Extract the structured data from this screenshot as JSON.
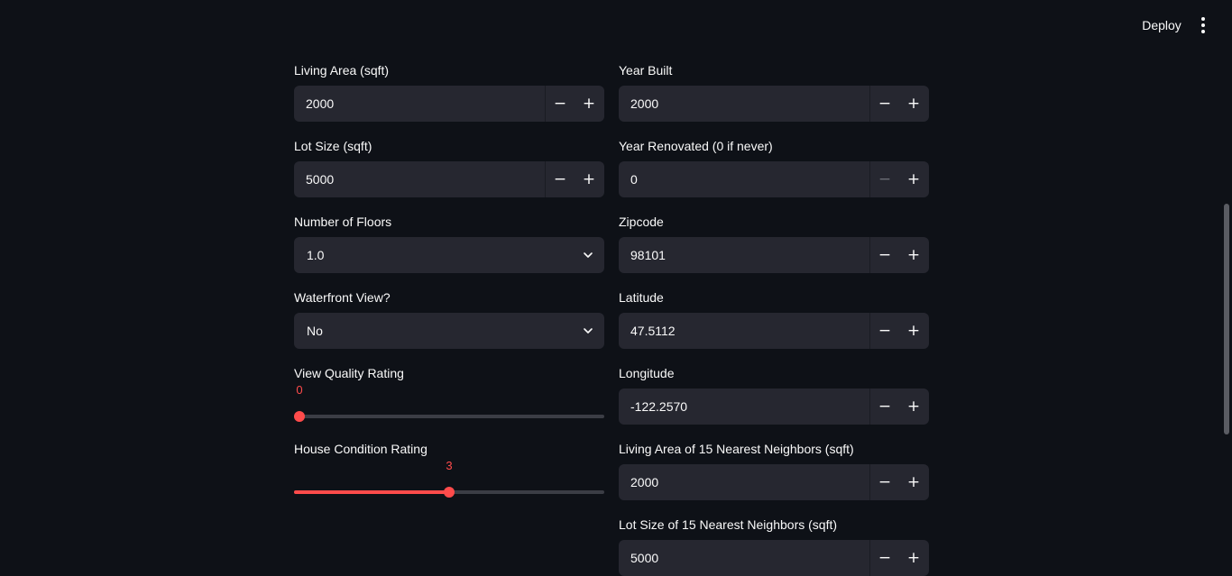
{
  "header": {
    "deploy_label": "Deploy",
    "menu_icon": "kebab-menu-icon"
  },
  "form": {
    "living_area": {
      "label": "Living Area (sqft)",
      "value": "2000"
    },
    "lot_size": {
      "label": "Lot Size (sqft)",
      "value": "5000"
    },
    "floors": {
      "label": "Number of Floors",
      "selected": "1.0"
    },
    "waterfront": {
      "label": "Waterfront View?",
      "selected": "No"
    },
    "view_rating": {
      "label": "View Quality Rating",
      "value": "0",
      "min": 0,
      "max": 4,
      "current": 0
    },
    "condition_rating": {
      "label": "House Condition Rating",
      "value": "3",
      "min": 1,
      "max": 5,
      "current": 3
    },
    "year_built": {
      "label": "Year Built",
      "value": "2000"
    },
    "year_renovated": {
      "label": "Year Renovated (0 if never)",
      "value": "0"
    },
    "zipcode": {
      "label": "Zipcode",
      "value": "98101"
    },
    "latitude": {
      "label": "Latitude",
      "value": "47.5112"
    },
    "longitude": {
      "label": "Longitude",
      "value": "-122.2570"
    },
    "living_area_15": {
      "label": "Living Area of 15 Nearest Neighbors (sqft)",
      "value": "2000"
    },
    "lot_size_15": {
      "label": "Lot Size of 15 Nearest Neighbors (sqft)",
      "value": "5000"
    }
  },
  "stepper": {
    "minus": "−",
    "plus": "+"
  },
  "colors": {
    "accent": "#ff4b4b",
    "background": "#0e1117",
    "input_bg": "#262730"
  }
}
